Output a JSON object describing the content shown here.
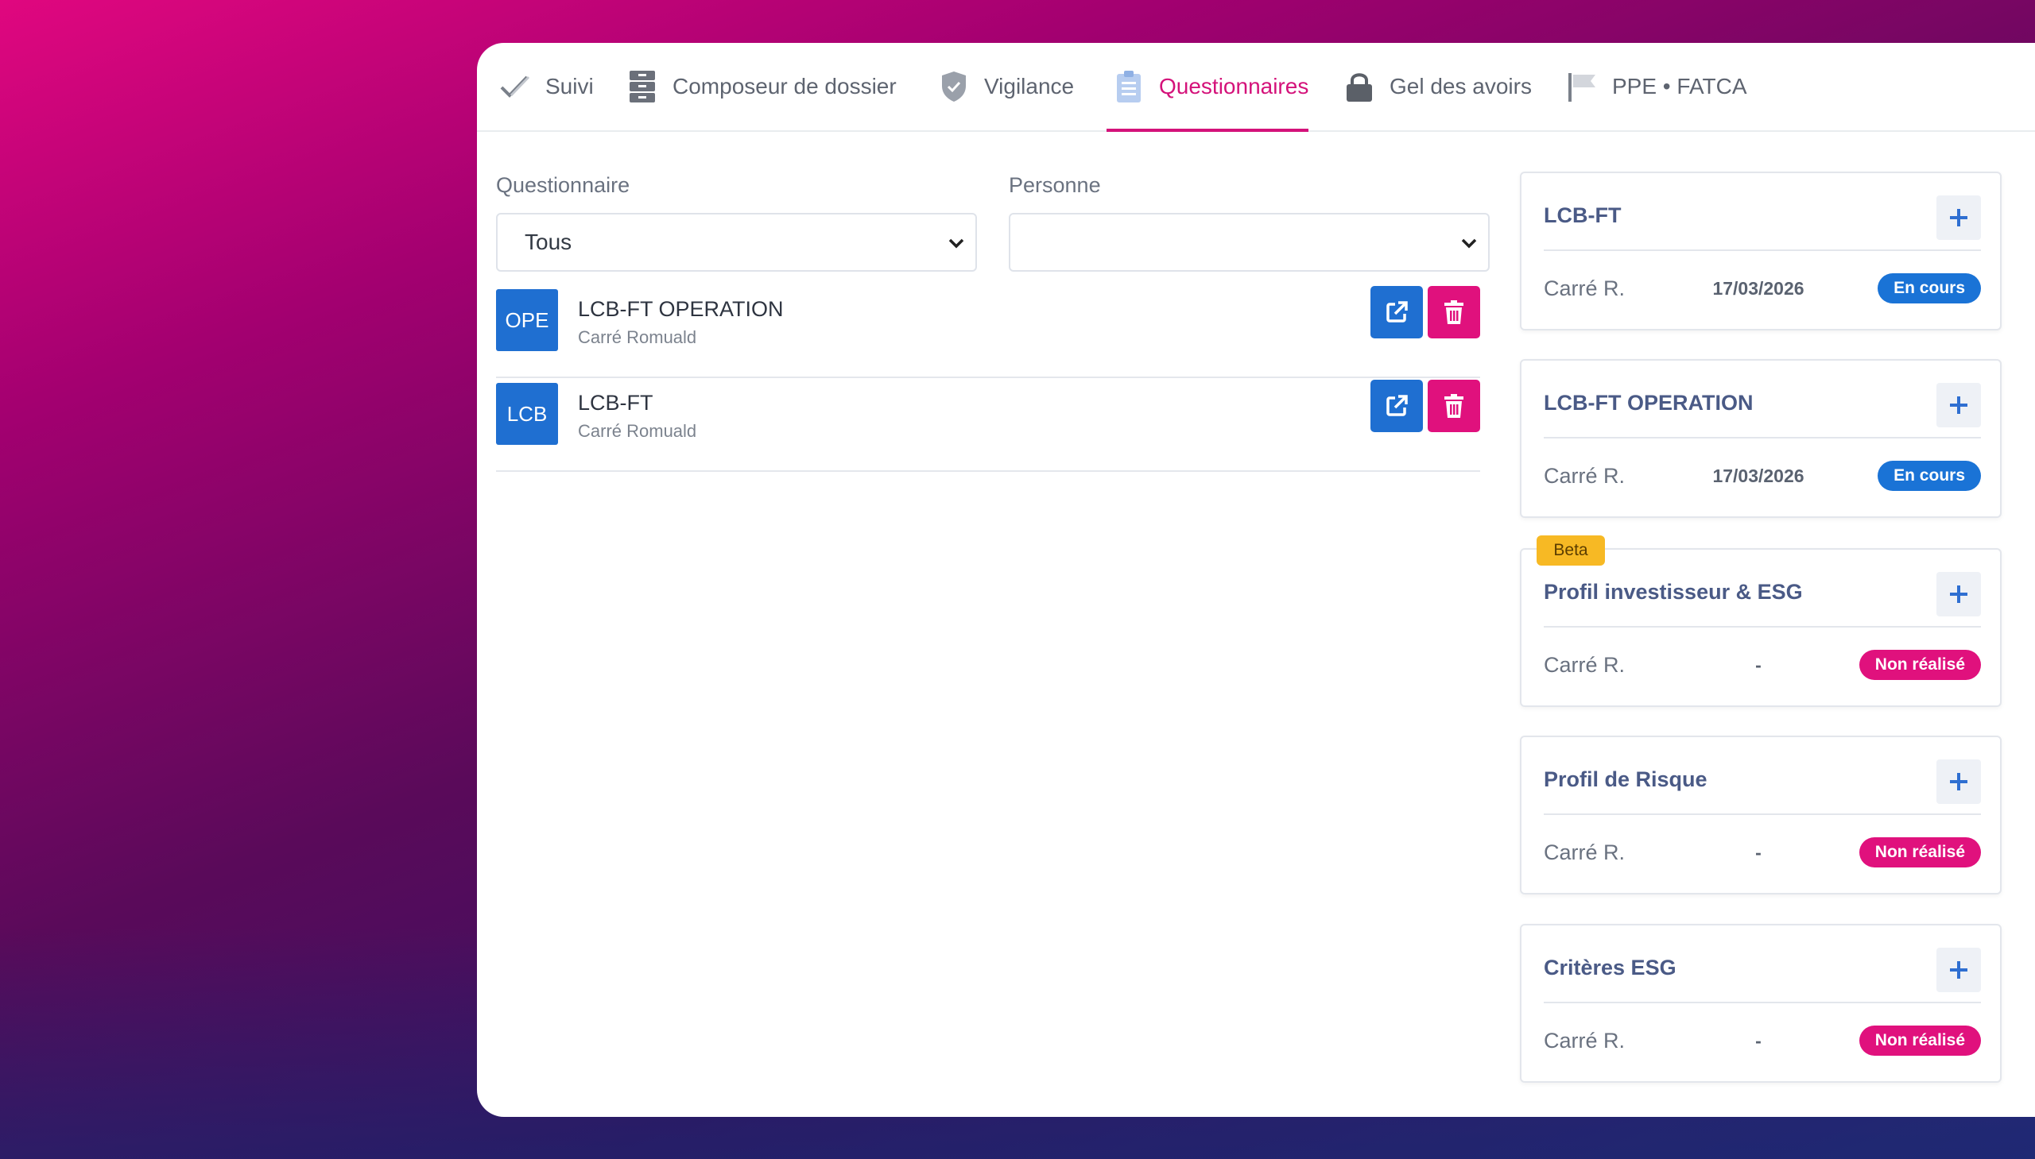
{
  "tabs": [
    {
      "label": "Suivi",
      "icon": "check-icon"
    },
    {
      "label": "Composeur de dossier",
      "icon": "archive-icon"
    },
    {
      "label": "Vigilance",
      "icon": "shield-check-icon"
    },
    {
      "label": "Questionnaires",
      "icon": "clipboard-icon",
      "active": true
    },
    {
      "label": "Gel des avoirs",
      "icon": "lock-icon"
    },
    {
      "label": "PPE • FATCA",
      "icon": "flag-icon"
    }
  ],
  "filters": {
    "questionnaire_label": "Questionnaire",
    "questionnaire_value": "Tous",
    "personne_label": "Personne",
    "personne_value": ""
  },
  "list": [
    {
      "avatar": "OPE",
      "title": "LCB-FT OPERATION",
      "person": "Carré Romuald"
    },
    {
      "avatar": "LCB",
      "title": "LCB-FT",
      "person": "Carré Romuald"
    }
  ],
  "cards": [
    {
      "title": "LCB-FT",
      "person": "Carré R.",
      "date": "17/03/2026",
      "status": "En cours",
      "status_color": "#1a73d6"
    },
    {
      "title": "LCB-FT OPERATION",
      "person": "Carré R.",
      "date": "17/03/2026",
      "status": "En cours",
      "status_color": "#1a73d6"
    },
    {
      "title": "Profil investisseur & ESG",
      "person": "Carré R.",
      "date": "-",
      "status": "Non réalisé",
      "status_color": "#e0117d",
      "beta": "Beta"
    },
    {
      "title": "Profil de Risque",
      "person": "Carré R.",
      "date": "-",
      "status": "Non réalisé",
      "status_color": "#e0117d"
    },
    {
      "title": "Critères ESG",
      "person": "Carré R.",
      "date": "-",
      "status": "Non réalisé",
      "status_color": "#e0117d"
    }
  ],
  "colors": {
    "accent": "#d4127a",
    "primary_blue": "#1f6fd1",
    "danger": "#e0117d",
    "beta": "#f7b924"
  }
}
